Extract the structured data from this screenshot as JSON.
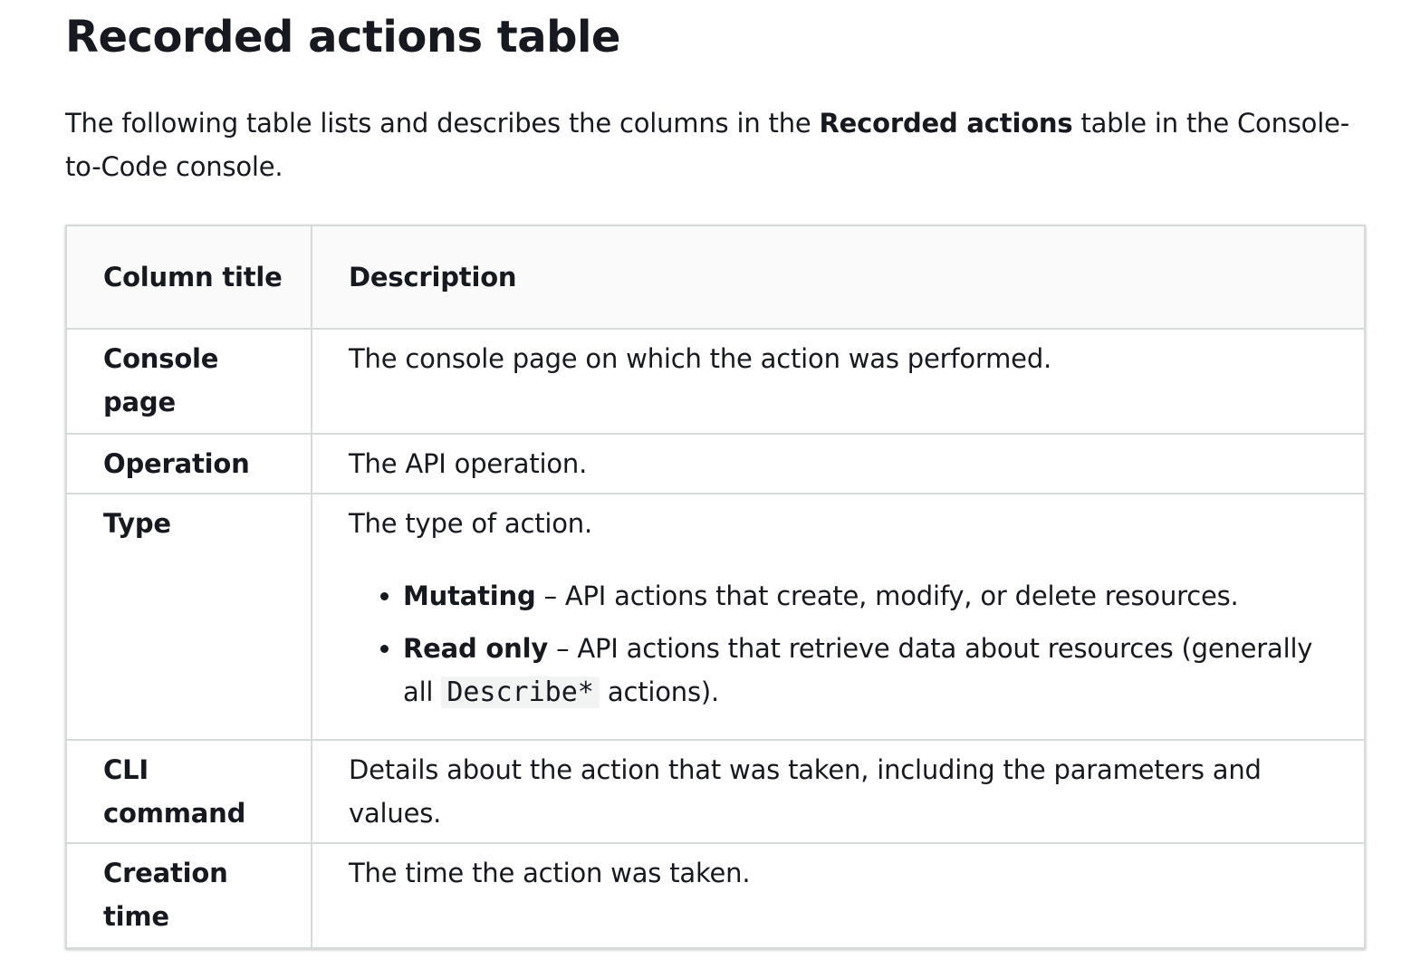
{
  "heading": "Recorded actions table",
  "intro": {
    "before": "The following table lists and describes the columns in the ",
    "bold": "Recorded actions",
    "after": " table in the Console-to-Code console."
  },
  "table": {
    "headers": {
      "col1": "Column title",
      "col2": "Description"
    },
    "rows": [
      {
        "title": "Console page",
        "description": "The console page on which the action was performed."
      },
      {
        "title": "Operation",
        "description": "The API operation."
      },
      {
        "title": "Type",
        "description": "The type of action.",
        "bullets": [
          {
            "term": "Mutating",
            "text": " – API actions that create, modify, or delete resources."
          },
          {
            "term": "Read only",
            "text": " – API actions that retrieve data about resources (generally all ",
            "code": "Describe*",
            "after": " actions)."
          }
        ]
      },
      {
        "title": "CLI command",
        "description": "Details about the action that was taken, including the parameters and values."
      },
      {
        "title": "Creation time",
        "description": "The time the action was taken."
      }
    ]
  }
}
